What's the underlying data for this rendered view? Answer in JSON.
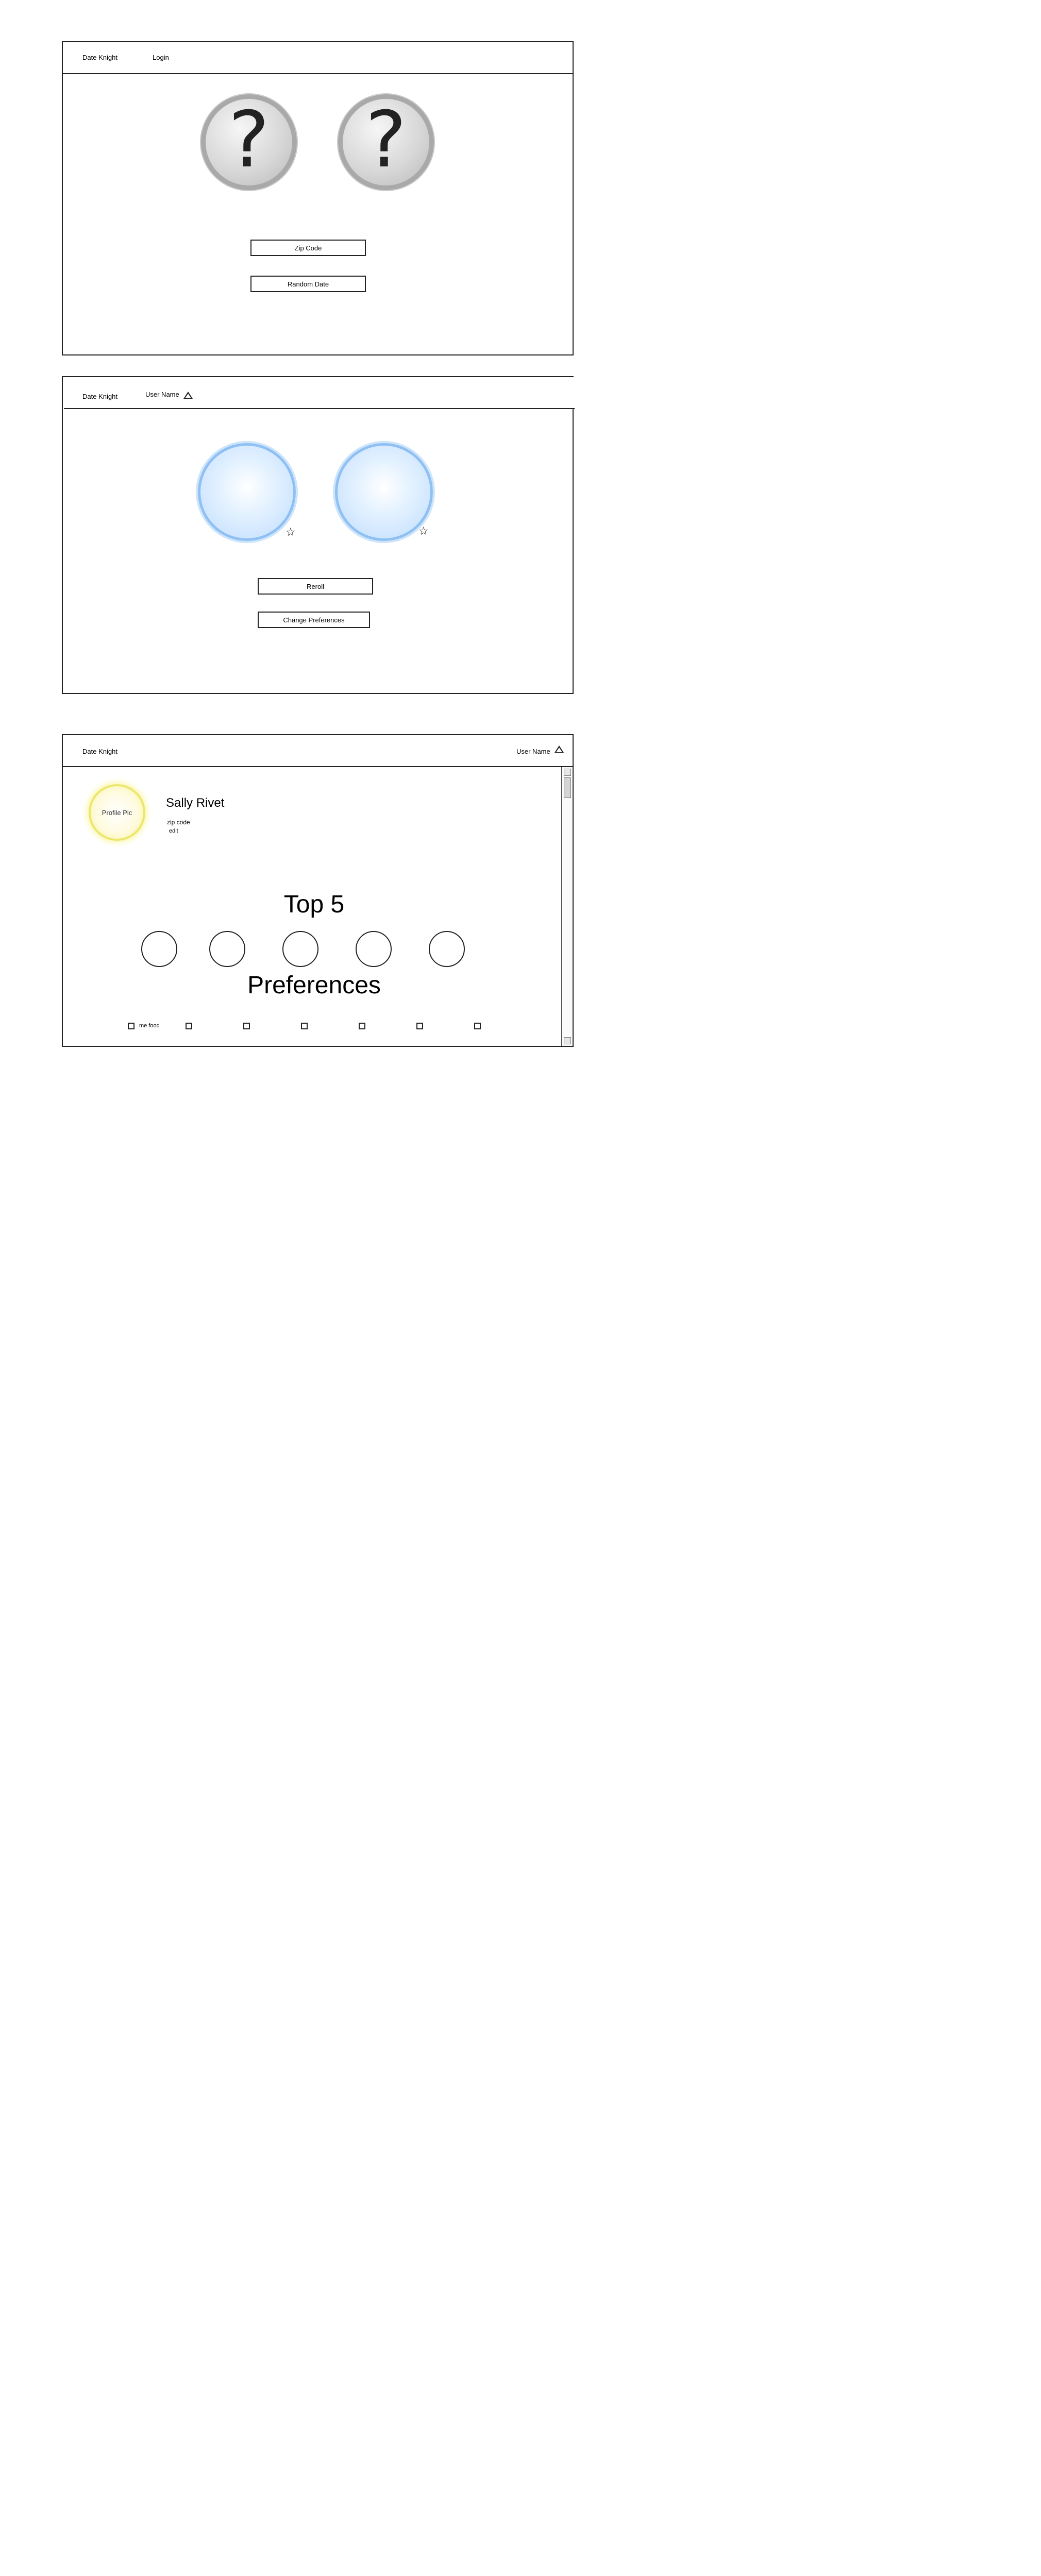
{
  "screen1": {
    "brand": "Date Knight",
    "login": "Login",
    "orb_glyph": "?",
    "zip_button": "Zip Code",
    "random_button": "Random Date"
  },
  "screen2": {
    "brand": "Date Knight",
    "user_name": "User Name",
    "star_glyph": "☆",
    "reroll_button": "Reroll",
    "change_prefs_button": "Change Preferences"
  },
  "screen3": {
    "brand": "Date Knight",
    "user_name": "User Name",
    "profile_pic": "Profile Pic",
    "profile_name": "Sally Rivet",
    "zip_code": "zip code",
    "edit": "edit",
    "top5_title": "Top 5",
    "preferences_title": "Preferences",
    "preference_options": [
      "me food",
      "",
      "",
      "",
      "",
      "",
      ""
    ]
  },
  "icons": [
    "question-mark-icon",
    "star-icon",
    "triangle-icon",
    "checkbox-icon"
  ],
  "colors": {
    "border": "#222222",
    "gray_orb": "#b9b9b9",
    "blue_orb": "#8fc0f3",
    "profile_glow": "#f0ec6a"
  }
}
